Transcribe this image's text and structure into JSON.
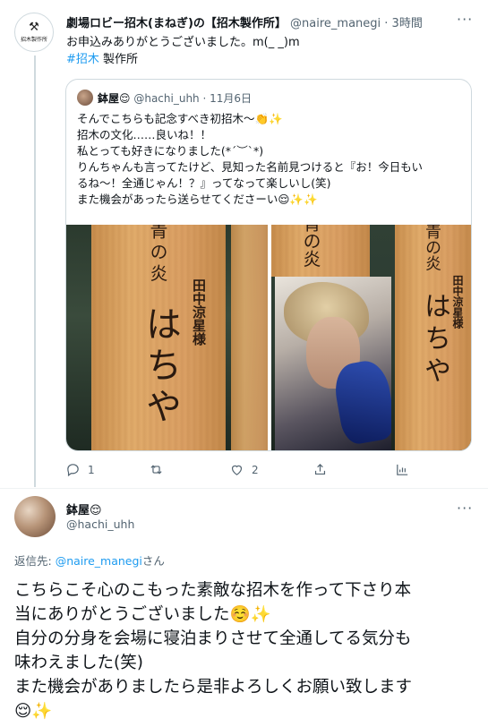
{
  "tweet1": {
    "avatar_text": "招木製作所",
    "avatar_icon": "hammer-icon",
    "display_name": "劇場ロビー招木(まねぎ)の【招木製作所】",
    "handle": "@naire_manegi",
    "time": "· 3時間",
    "text_line1": "お申込みありがとうございました。m(_ _)m",
    "hashtag": "#招木",
    "text_after_hashtag": " 製作所",
    "quote": {
      "display_name": "鉢屋😌",
      "handle": "@hachi_uhh",
      "date": "· 11月6日",
      "lines": [
        "そんでこちらも記念すべき初招木〜👏✨",
        "招木の文化……良いね！！",
        "私とっても好きになりました(*´︶`*)",
        "りんちゃんも言ってたけど、見知った名前見つけると『お！今日もい",
        "るね〜！全通じゃん！？』ってなって楽しいし(笑)",
        "また機会があったら送らせてくださーい😌✨✨"
      ],
      "images": {
        "left": {
          "top_text": "青の炎",
          "name_text": "田中涼星様",
          "big_text": "はちや"
        },
        "right": {
          "top_text_a": "青の炎",
          "top_text_b": "青の炎",
          "name_text": "田中涼星様",
          "big_text": "はちや"
        }
      }
    },
    "actions": {
      "reply_count": "1",
      "retweet_count": "",
      "like_count": "2"
    }
  },
  "tweet2": {
    "display_name": "鉢屋😌",
    "handle": "@hachi_uhh",
    "reply_prefix": "返信先: ",
    "reply_handle": "@naire_manegi",
    "reply_suffix": "さん",
    "lines": [
      "こちらこそ心のこもった素敵な招木を作って下さり本",
      "当にありがとうございました☺️✨",
      "自分の分身を会場に寝泊まりさせて全通してる気分も",
      "味わえました(笑)",
      "また機会がありましたら是非よろしくお願い致します",
      "😌✨"
    ]
  },
  "colors": {
    "link": "#1d9bf0",
    "secondary_text": "#536471",
    "border": "#cfd9de"
  }
}
